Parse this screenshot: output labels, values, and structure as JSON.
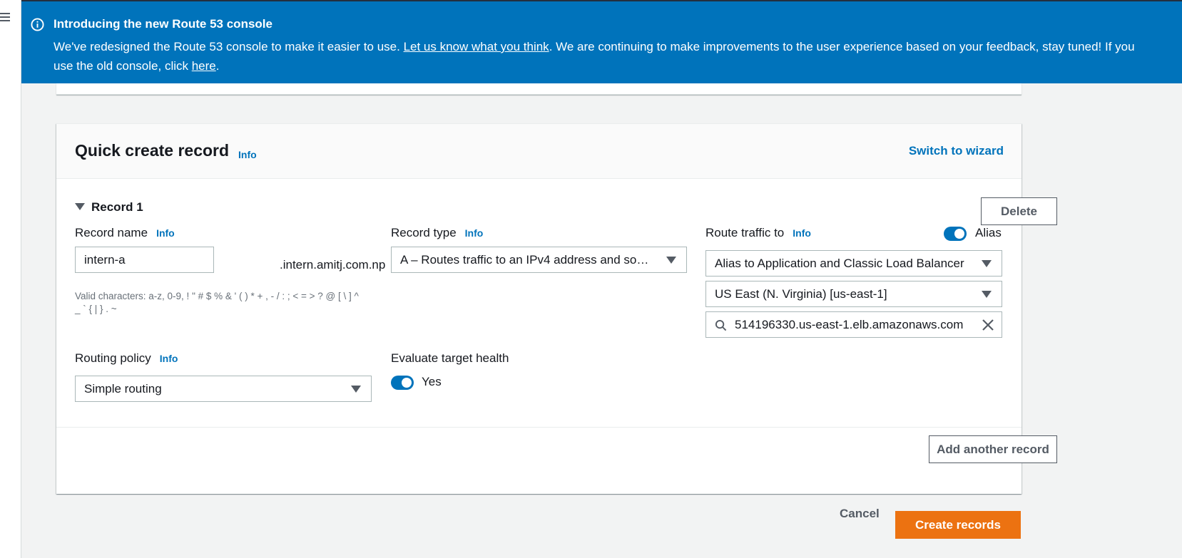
{
  "banner": {
    "icon": "info-icon",
    "title": "Introducing the new Route 53 console",
    "text_1": "We've redesigned the Route 53 console to make it easier to use. ",
    "feedback_link": "Let us know what you think",
    "text_2": ". We are continuing to make improvements to the user experience based on your feedback, stay tuned! If you",
    "text_3": "use the old console, click ",
    "here_link": "here",
    "text_4": ".",
    "color": "#0073bb"
  },
  "quick_create": {
    "title": "Quick create record",
    "info": "Info",
    "switch_wizard": "Switch to wizard",
    "record_label": "Record 1",
    "delete_label": "Delete",
    "record_name": {
      "label": "Record name",
      "info": "Info",
      "value": "intern-a",
      "suffix": ".intern.amitj.com.np",
      "hint": "Valid characters: a-z, 0-9, ! \" # $ % & ' ( ) * + , - / : ; < = > ? @ [ \\ ] ^ _ ` { | } . ~"
    },
    "record_type": {
      "label": "Record type",
      "info": "Info",
      "value": "A – Routes traffic to an IPv4 address and so…"
    },
    "route_traffic": {
      "label": "Route traffic to",
      "info": "Info",
      "alias_label": "Alias",
      "alias_on": true,
      "endpoint_type": "Alias to Application and Classic Load Balancer",
      "region": "US East (N. Virginia) [us-east-1]",
      "endpoint_value": "514196330.us-east-1.elb.amazonaws.com"
    },
    "routing_policy": {
      "label": "Routing policy",
      "info": "Info",
      "value": "Simple routing"
    },
    "evaluate_health": {
      "label": "Evaluate target health",
      "value_label": "Yes",
      "on": true
    },
    "add_another": "Add another record"
  },
  "actions": {
    "cancel": "Cancel",
    "create": "Create records",
    "create_color": "#ec7211"
  }
}
